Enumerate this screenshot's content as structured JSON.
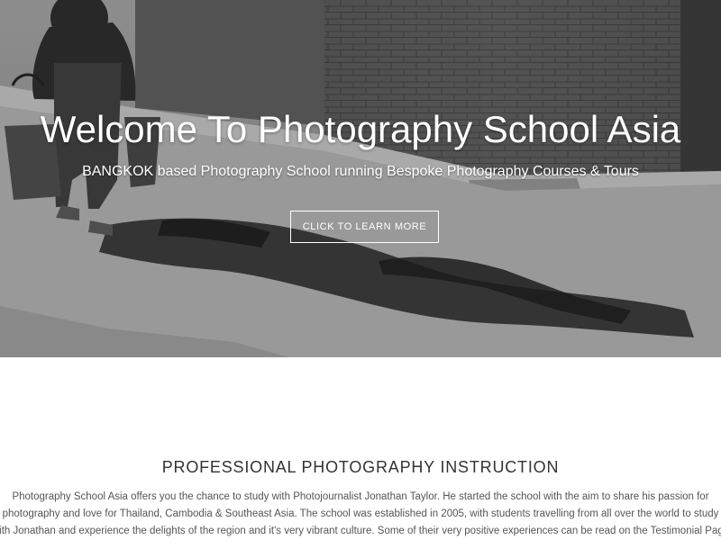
{
  "hero": {
    "title": "Welcome To Photography School Asia",
    "subtitle": "BANGKOK based Photography School running Bespoke Photography Courses & Tours",
    "cta_label": "CLICK TO LEARN MORE",
    "image_icon": "street-photo-image"
  },
  "section": {
    "heading": "PROFESSIONAL PHOTOGRAPHY INSTRUCTION",
    "lines": [
      "Photography School Asia offers you the chance to study with Photojournalist Jonathan Taylor. He started the school with the aim to share his passion for",
      "photography and love for Thailand, Cambodia & Southeast Asia. The school was established in 2005, with students travelling from all over the world to study",
      "with Jonathan and experience the delights of the region and it's very vibrant culture. Some of their very positive experiences can be read on the Testimonial Page"
    ]
  },
  "colors": {
    "background": "#ffffff",
    "heading": "#333333",
    "body_text": "#555555",
    "hero_text": "#ffffff"
  }
}
